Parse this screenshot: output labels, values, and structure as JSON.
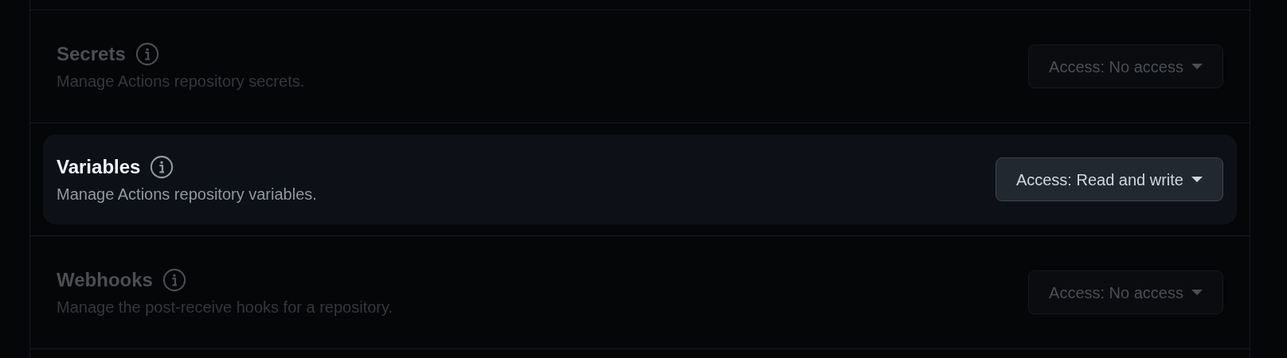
{
  "permissions": [
    {
      "title": "Secrets",
      "description": "Manage Actions repository secrets.",
      "access": "Access: No access",
      "disabled": true
    },
    {
      "title": "Variables",
      "description": "Manage Actions repository variables.",
      "access": "Access: Read and write",
      "disabled": false
    },
    {
      "title": "Webhooks",
      "description": "Manage the post-receive hooks for a repository.",
      "access": "Access: No access",
      "disabled": true
    }
  ]
}
